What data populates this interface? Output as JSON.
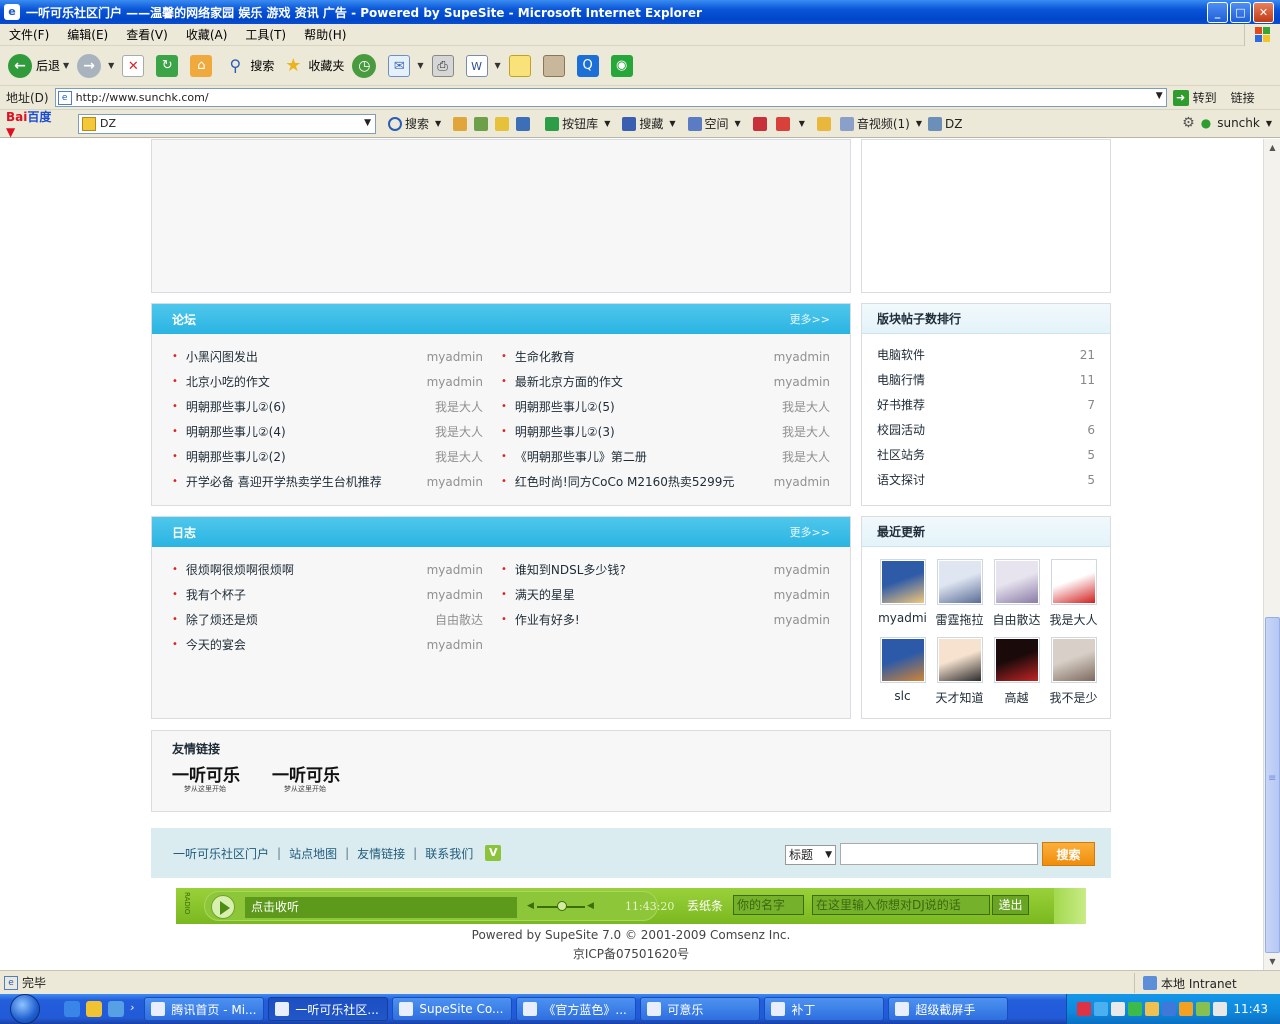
{
  "window": {
    "title": "一听可乐社区门户 ——温馨的网络家园 娱乐 游戏 资讯 广告 - Powered by SupeSite - Microsoft Internet Explorer",
    "ie_glyph": "e",
    "minimize": "_",
    "maximize": "□",
    "close": "✕"
  },
  "menu": [
    "文件(F)",
    "编辑(E)",
    "查看(V)",
    "收藏(A)",
    "工具(T)",
    "帮助(H)"
  ],
  "toolbar": {
    "back": "后退",
    "search": "搜索",
    "favorites": "收藏夹"
  },
  "address": {
    "label": "地址(D)",
    "url": "http://www.sunchk.com/",
    "go": "转到",
    "links": "链接"
  },
  "baidu": {
    "logo_a": "Bai",
    "logo_b": "百度",
    "query": "DZ",
    "search": "搜索",
    "buttons": "按钮库",
    "collect": "搜藏",
    "space": "空间",
    "media": "音视频(1)",
    "dz": "DZ",
    "user": "sunchk"
  },
  "forum": {
    "title": "论坛",
    "more": "更多>>",
    "left": [
      {
        "t": "小黑闪图发出",
        "a": "myadmin"
      },
      {
        "t": "北京小吃的作文",
        "a": "myadmin"
      },
      {
        "t": "明朝那些事儿②(6)",
        "a": "我是大人"
      },
      {
        "t": "明朝那些事儿②(4)",
        "a": "我是大人"
      },
      {
        "t": "明朝那些事儿②(2)",
        "a": "我是大人"
      },
      {
        "t": "开学必备 喜迎开学热卖学生台机推荐",
        "a": "myadmin"
      }
    ],
    "right": [
      {
        "t": "生命化教育",
        "a": "myadmin"
      },
      {
        "t": "最新北京方面的作文",
        "a": "myadmin"
      },
      {
        "t": "明朝那些事儿②(5)",
        "a": "我是大人"
      },
      {
        "t": "明朝那些事儿②(3)",
        "a": "我是大人"
      },
      {
        "t": "《明朝那些事儿》第二册",
        "a": "我是大人"
      },
      {
        "t": "红色时尚!同方CoCo M2160热卖5299元",
        "a": "myadmin"
      }
    ]
  },
  "rank": {
    "title": "版块帖子数排行",
    "items": [
      {
        "name": "电脑软件",
        "count": "21"
      },
      {
        "name": "电脑行情",
        "count": "11"
      },
      {
        "name": "好书推荐",
        "count": "7"
      },
      {
        "name": "校园活动",
        "count": "6"
      },
      {
        "name": "社区站务",
        "count": "5"
      },
      {
        "name": "语文探讨",
        "count": "5"
      }
    ]
  },
  "blog": {
    "title": "日志",
    "more": "更多>>",
    "left": [
      {
        "t": "很烦啊很烦啊很烦啊",
        "a": "myadmin"
      },
      {
        "t": "我有个杯子",
        "a": "myadmin"
      },
      {
        "t": "除了烦还是烦",
        "a": "自由散达"
      },
      {
        "t": "今天的宴会",
        "a": "myadmin"
      }
    ],
    "right": [
      {
        "t": "谁知到NDSL多少钱?",
        "a": "myadmin"
      },
      {
        "t": "满天的星星",
        "a": "myadmin"
      },
      {
        "t": "作业有好多!",
        "a": "myadmin"
      }
    ]
  },
  "recent": {
    "title": "最近更新",
    "users": [
      {
        "name": "myadmi",
        "color1": "#2e5ba8",
        "color2": "#f2c77b"
      },
      {
        "name": "雷霆拖拉",
        "color1": "#dfe6f2",
        "color2": "#5a6b95"
      },
      {
        "name": "自由散达",
        "color1": "#e8e4ef",
        "color2": "#8a7ba6"
      },
      {
        "name": "我是大人",
        "color1": "#ffffff",
        "color2": "#d21f1f"
      },
      {
        "name": "slc",
        "color1": "#2c5aa8",
        "color2": "#d08436"
      },
      {
        "name": "天才知道",
        "color1": "#f6e2cf",
        "color2": "#2b2b2b"
      },
      {
        "name": "高越",
        "color1": "#1a0a0a",
        "color2": "#c22525"
      },
      {
        "name": "我不是少",
        "color1": "#d8d0c8",
        "color2": "#7d6a5e"
      }
    ]
  },
  "friendlinks": {
    "title": "友情链接",
    "logos": [
      {
        "big": "一听可乐",
        "small": "梦从这里开始"
      },
      {
        "big": "一听可乐",
        "small": "梦从这里开始"
      }
    ]
  },
  "footer": {
    "links": [
      "一听可乐社区门户",
      "站点地图",
      "友情链接",
      "联系我们"
    ],
    "v": "V",
    "select": "标题",
    "search_btn": "搜索"
  },
  "radio": {
    "tag": "RADIO",
    "track": "点击收听",
    "time": "11:43:20",
    "drop": "丢纸条",
    "name_ph": "你的名字",
    "msg_ph": "在这里输入你想对DJ说的话",
    "send": "递出"
  },
  "copyright": {
    "line1": "Powered by SupeSite 7.0 © 2001-2009 Comsenz Inc.",
    "line2": "京ICP备07501620号"
  },
  "status": {
    "text": "完毕",
    "zone": "本地 Intranet"
  },
  "taskbar": {
    "tasks": [
      "腾讯首页 - Mi...",
      "一听可乐社区...",
      "SupeSite Co...",
      "《官方蓝色》...",
      "可意乐",
      "补丁",
      "超级截屏手"
    ],
    "clock": "11:43"
  }
}
